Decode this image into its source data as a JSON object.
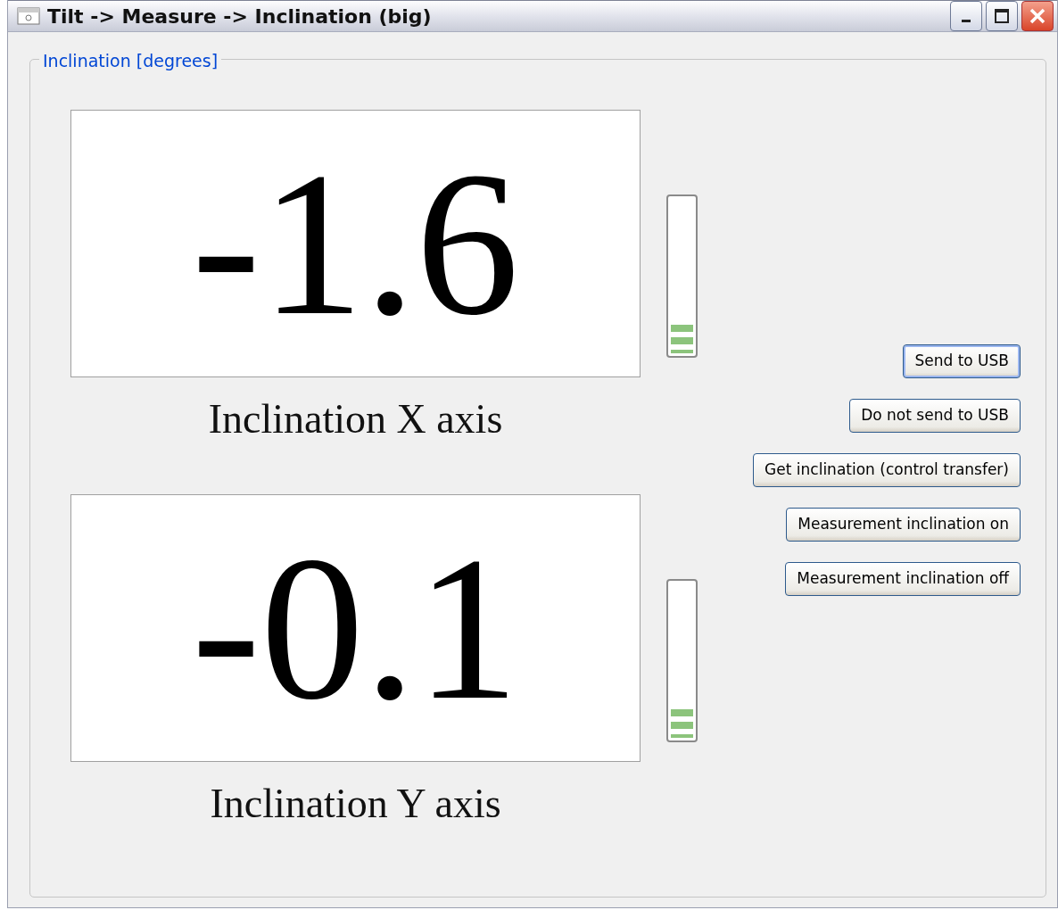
{
  "window": {
    "title": "Tilt -> Measure -> Inclination (big)"
  },
  "group": {
    "title": "Inclination [degrees]"
  },
  "readouts": [
    {
      "value": "-1.6",
      "label": "Inclination X axis",
      "level": 0.2
    },
    {
      "value": "-0.1",
      "label": "Inclination Y axis",
      "level": 0.2
    }
  ],
  "buttons": [
    {
      "label": "Send to USB",
      "default": true
    },
    {
      "label": "Do not send to USB",
      "default": false
    },
    {
      "label": "Get inclination (control transfer)",
      "default": false
    },
    {
      "label": "Measurement inclination on",
      "default": false
    },
    {
      "label": "Measurement inclination off",
      "default": false
    }
  ]
}
